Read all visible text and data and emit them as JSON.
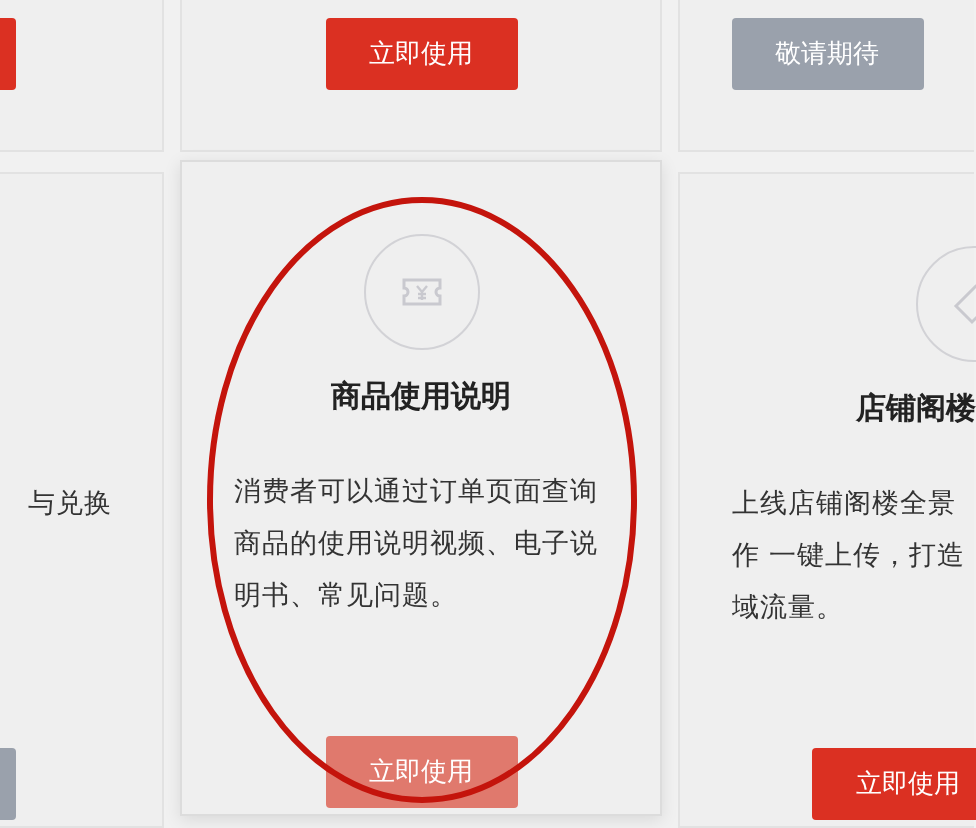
{
  "cards": [
    {
      "button": {
        "kind": "primary"
      }
    },
    {
      "hovered": false,
      "button": {
        "label": "立即使用",
        "kind": "primary"
      }
    },
    {
      "hovered": false,
      "button": {
        "label": "敬请期待",
        "kind": "pending"
      }
    },
    {
      "hovered": false,
      "description": [
        "与兑换"
      ],
      "button": {
        "kind": "pending"
      }
    },
    {
      "hovered": true,
      "title": "商品使用说明",
      "description": [
        "消费者可以通过订单页面查询",
        "商品的使用说明视频、电子说",
        "明书、常见问题。"
      ],
      "button": {
        "label": "立即使用",
        "kind": "muted"
      }
    },
    {
      "hovered": false,
      "title": "店铺阁楼",
      "description": [
        "上线店铺阁楼全景",
        "作 一键上传，打造",
        "域流量。"
      ],
      "button": {
        "label": "立即使用",
        "kind": "primary"
      }
    }
  ]
}
